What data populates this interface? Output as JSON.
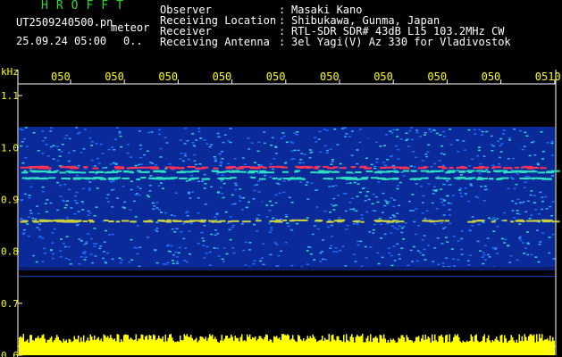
{
  "header": {
    "brand": "HROFFT",
    "filename": "UT2509240500.pn",
    "tag": "meteor",
    "datetime": "25.09.24 05:00",
    "dots": "0..",
    "observer_label": "Observer",
    "observer_value": "Masaki Kano",
    "location_label": "Receiving Location",
    "location_value": "Shibukawa, Gunma, Japan",
    "receiver_label": "Receiver",
    "receiver_value": "RTL-SDR SDR# 43dB L15 103.2MHz CW",
    "antenna_label": "Receiving Antenna",
    "antenna_value": "3el Yagi(V) Az 330 for Vladivostok",
    "colon": ":"
  },
  "chart_data": {
    "type": "heatmap",
    "ylabel": "kHz",
    "ylim": [
      0.6,
      1.15
    ],
    "y_ticks": [
      "1.1",
      "1.0",
      "0.9",
      "0.8",
      "0.7",
      "0.6"
    ],
    "x_ticks": [
      "050",
      "050",
      "050",
      "050",
      "050",
      "050",
      "050",
      "050",
      "050",
      "0510"
    ],
    "noise_band_khz": [
      0.77,
      1.04
    ],
    "traces_khz": [
      0.963,
      0.955,
      0.942,
      0.86
    ],
    "colors": {
      "background": "#000000",
      "axis": "#ffff00",
      "noise_low": "#0a2a9a",
      "noise_mid": "#1f6cff",
      "noise_high": "#2fd8c8",
      "trace": "#ff3355",
      "amplitude": "#ffff00"
    }
  }
}
